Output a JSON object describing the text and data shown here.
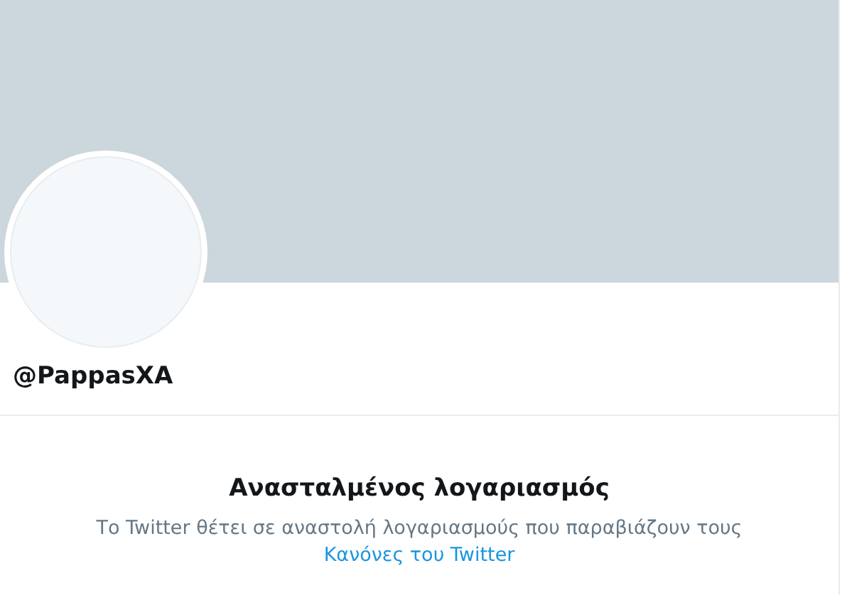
{
  "profile": {
    "handle": "@PappasXA"
  },
  "notice": {
    "title": "Ανασταλμένος λογαριασμός",
    "text": "Το Twitter θέτει σε αναστολή λογαριασμούς που παραβιάζουν τους",
    "link": "Κανόνες του Twitter"
  }
}
